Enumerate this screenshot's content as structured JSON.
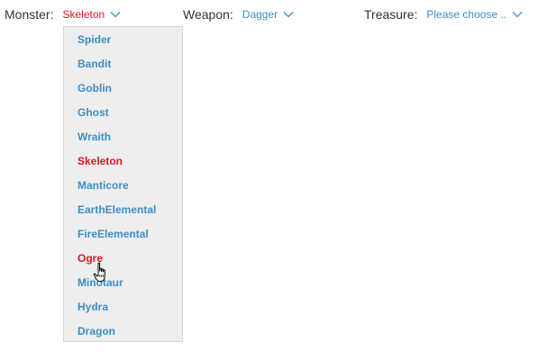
{
  "colors": {
    "link": "#3a8fc8",
    "selected": "#e0141e",
    "label": "#333333"
  },
  "monster": {
    "label": "Monster:",
    "value": "Skeleton",
    "icon": "chevron-down-icon"
  },
  "weapon": {
    "label": "Weapon:",
    "value": "Dagger",
    "icon": "chevron-down-icon"
  },
  "treasure": {
    "label": "Treasure:",
    "placeholder": "Please choose ..",
    "icon": "chevron-down-icon"
  },
  "monster_dropdown": {
    "options": [
      {
        "label": "Spider",
        "state": "normal"
      },
      {
        "label": "Bandit",
        "state": "normal"
      },
      {
        "label": "Goblin",
        "state": "normal"
      },
      {
        "label": "Ghost",
        "state": "normal"
      },
      {
        "label": "Wraith",
        "state": "normal"
      },
      {
        "label": "Skeleton",
        "state": "selected"
      },
      {
        "label": "Manticore",
        "state": "normal"
      },
      {
        "label": "EarthElemental",
        "state": "normal"
      },
      {
        "label": "FireElemental",
        "state": "normal"
      },
      {
        "label": "Ogre",
        "state": "hovered"
      },
      {
        "label": "Minotaur",
        "state": "normal"
      },
      {
        "label": "Hydra",
        "state": "normal"
      },
      {
        "label": "Dragon",
        "state": "normal"
      }
    ]
  },
  "pointer": {
    "icon": "hand-pointer-icon"
  }
}
